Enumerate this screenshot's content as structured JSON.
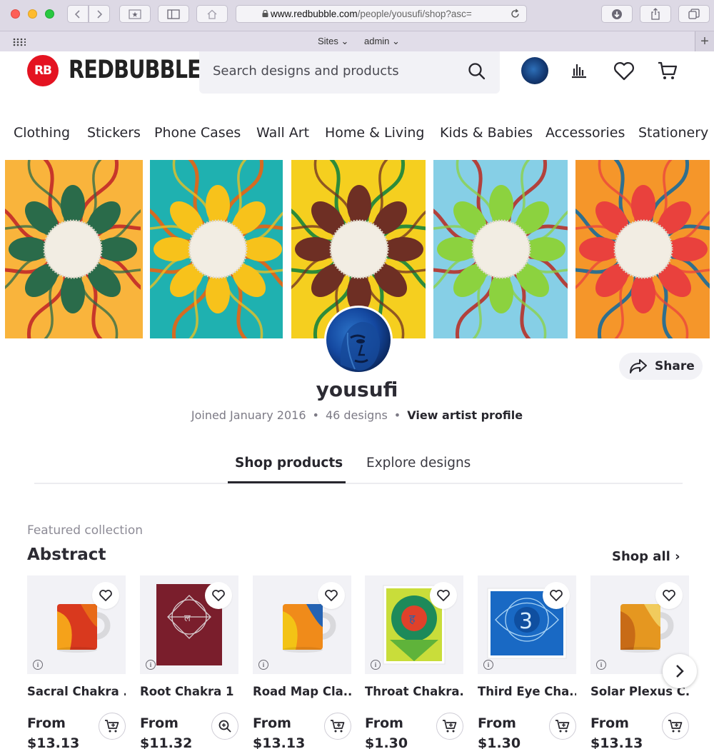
{
  "browser": {
    "url_host": "www.redbubble.com",
    "url_path": "/people/yousufi/shop?asc=",
    "toolbar_menus": [
      "Sites",
      "admin"
    ]
  },
  "header": {
    "logo_mark": "RB",
    "logo_text": "REDBUBBLE",
    "search_placeholder": "Search designs and products"
  },
  "nav": {
    "categories": [
      "Clothing",
      "Stickers",
      "Phone Cases",
      "Wall Art",
      "Home & Living",
      "Kids & Babies",
      "Accessories",
      "Stationery"
    ]
  },
  "banner": {
    "tiles": [
      {
        "bg": "#f9b43c",
        "petal": "#2a6b4a",
        "stroke": "#c7372a"
      },
      {
        "bg": "#1fb1b0",
        "petal": "#f7c21b",
        "stroke": "#d56b22"
      },
      {
        "bg": "#f5cf1f",
        "petal": "#6e2f24",
        "stroke": "#2d8b3a"
      },
      {
        "bg": "#86cfe6",
        "petal": "#8cd23f",
        "stroke": "#b2413c"
      },
      {
        "bg": "#f5962a",
        "petal": "#e9413d",
        "stroke": "#2f6f8e"
      }
    ]
  },
  "profile": {
    "username": "yousufi",
    "joined": "Joined January 2016",
    "designs": "46 designs",
    "view_profile": "View artist profile",
    "share": "Share"
  },
  "tabs": [
    "Shop products",
    "Explore designs"
  ],
  "collection": {
    "label": "Featured collection",
    "title": "Abstract",
    "shop_all": "Shop all"
  },
  "products": [
    {
      "title": "Sacral Chakra ...",
      "from": "From",
      "price": "$13.13",
      "kind": "mug",
      "action": "cart"
    },
    {
      "title": "Root Chakra 1 ...",
      "from": "From",
      "price": "$11.32",
      "kind": "print",
      "action": "zoom"
    },
    {
      "title": "Road Map Cla...",
      "from": "From",
      "price": "$13.13",
      "kind": "mug",
      "action": "cart"
    },
    {
      "title": "Throat Chakra...",
      "from": "From",
      "price": "$1.30",
      "kind": "sticker",
      "action": "cart"
    },
    {
      "title": "Third Eye Cha...",
      "from": "From",
      "price": "$1.30",
      "kind": "sticker",
      "action": "cart"
    },
    {
      "title": "Solar Plexus C...",
      "from": "From",
      "price": "$13.13",
      "kind": "mug",
      "action": "cart"
    }
  ]
}
